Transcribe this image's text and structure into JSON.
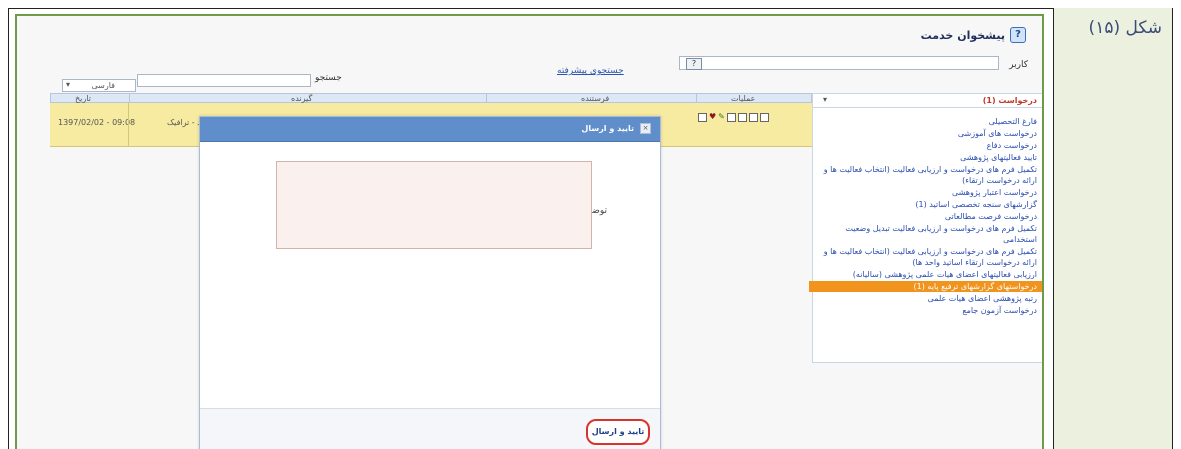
{
  "figure_label": "شکل (۱۵)",
  "page": {
    "title": "پیشخوان خدمت"
  },
  "filters": {
    "code_label": "کاربر",
    "advanced_search_link": "جستجوی پیشرفته",
    "search_label": "جستجو",
    "select_value": "فارسی"
  },
  "grid": {
    "headers": [
      "تاریخ",
      "گیرنده",
      "فرستنده",
      "عملیات"
    ],
    "rows": [
      {
        "date": "1397/02/02 - 09:08",
        "text": "ارشد - ترافیک"
      }
    ],
    "ops_icons": [
      "print-icon",
      "heart-icon",
      "edit-icon",
      "document-icon",
      "copy-icon",
      "list-icon",
      "window-icon"
    ]
  },
  "sidebar": {
    "header_label": "درخواست (1)",
    "items": [
      {
        "label": "فارغ التحصیلی",
        "active": false
      },
      {
        "label": "درخواست های آموزشی",
        "active": false
      },
      {
        "label": "درخواست دفاع",
        "active": false
      },
      {
        "label": "تایید فعالیتهای پژوهشی",
        "active": false
      },
      {
        "label": "تکمیل فرم های درخواست و ارزیابی فعالیت (انتخاب فعالیت ها و ارائه درخواست ارتقاء)",
        "active": false
      },
      {
        "label": "درخواست اعتبار پژوهشی",
        "active": false
      },
      {
        "label": "گزارشهای سنجه تخصصی اساتید (1)",
        "active": false
      },
      {
        "label": "درخواست فرصت مطالعاتی",
        "active": false
      },
      {
        "label": "تکمیل فرم های درخواست و ارزیابی فعالیت تبدیل وضعیت استخدامی",
        "active": false
      },
      {
        "label": "تکمیل فرم های درخواست و ارزیابی فعالیت (انتخاب فعالیت ها و ارائه درخواست ارتقاء اساتید واحد ها)",
        "active": false
      },
      {
        "label": "ارزیابی فعالیتهای اعضای هیات علمی پژوهشی (سالیانه)",
        "active": false
      },
      {
        "label": "درخواستهای گزارشهای ترفیع پایه (1)",
        "active": true
      },
      {
        "label": "رتبه پژوهشی اعضای هیات علمی",
        "active": false
      },
      {
        "label": "درخواست آزمون جامع",
        "active": false
      }
    ]
  },
  "modal": {
    "title": "تایید و ارسال",
    "desc_label": "توضیح",
    "desc_value": "",
    "confirm_label": "تایید و ارسال"
  }
}
